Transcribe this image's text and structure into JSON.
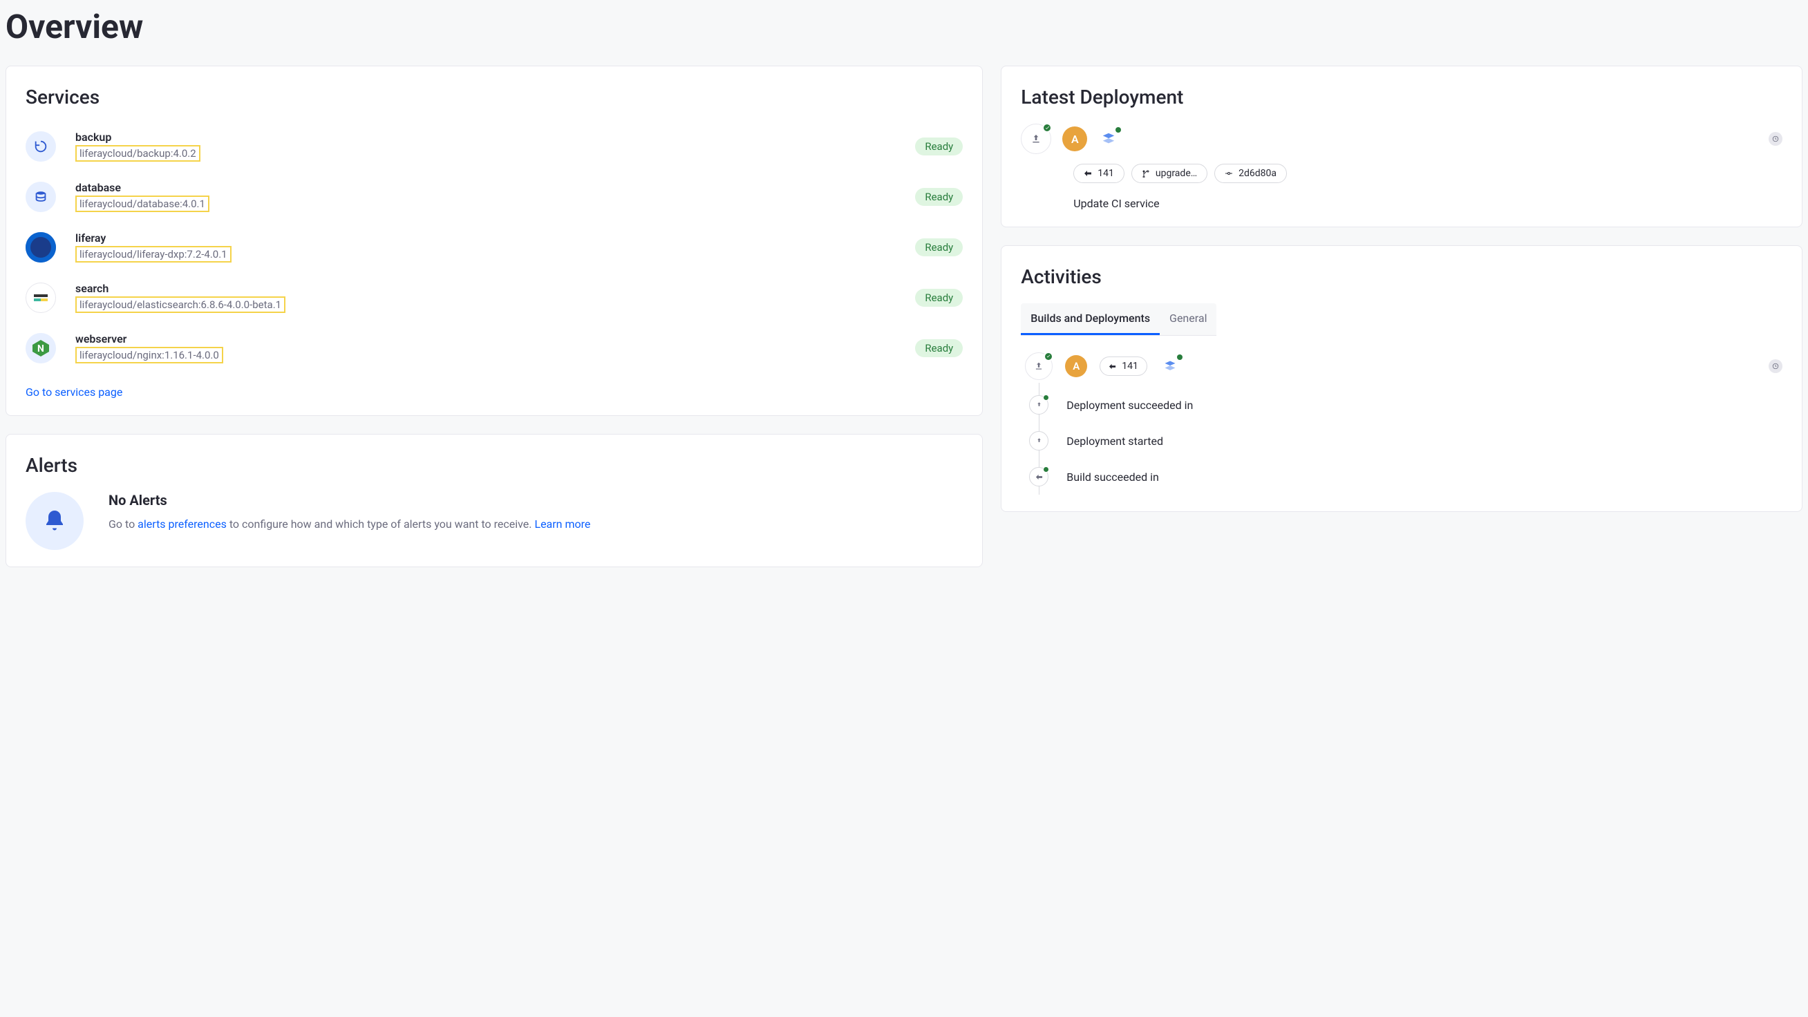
{
  "page_title": "Overview",
  "services_title": "Services",
  "services_link": "Go to services page",
  "services": [
    {
      "name": "backup",
      "image": "liferaycloud/backup:4.0.2",
      "status": "Ready"
    },
    {
      "name": "database",
      "image": "liferaycloud/database:4.0.1",
      "status": "Ready"
    },
    {
      "name": "liferay",
      "image": "liferaycloud/liferay-dxp:7.2-4.0.1",
      "status": "Ready"
    },
    {
      "name": "search",
      "image": "liferaycloud/elasticsearch:6.8.6-4.0.0-beta.1",
      "status": "Ready"
    },
    {
      "name": "webserver",
      "image": "liferaycloud/nginx:1.16.1-4.0.0",
      "status": "Ready"
    }
  ],
  "alerts": {
    "title": "Alerts",
    "headline": "No Alerts",
    "prefix": "Go to ",
    "pref_link": "alerts preferences",
    "middle": " to configure how and which type of alerts you want to receive. ",
    "learn": "Learn more"
  },
  "deployment": {
    "title": "Latest Deployment",
    "avatar_letter": "A",
    "pills": {
      "build": "141",
      "branch": "upgrade…",
      "commit": "2d6d80a"
    },
    "message": "Update CI service"
  },
  "activities": {
    "title": "Activities",
    "tabs": {
      "builds": "Builds and Deployments",
      "general": "General"
    },
    "avatar_letter": "A",
    "build_pill": "141",
    "events": [
      "Deployment succeeded in",
      "Deployment started",
      "Build succeeded in"
    ]
  }
}
